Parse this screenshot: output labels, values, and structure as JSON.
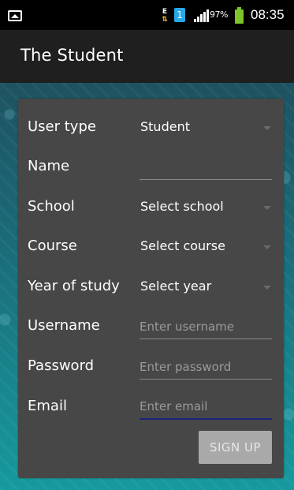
{
  "status_bar": {
    "data_indicator": "E",
    "sim_number": "1",
    "battery_percent": "97%",
    "time": "08:35",
    "battery_color": "#7ec32a",
    "sim_color": "#27a7e7"
  },
  "action_bar": {
    "title": "The Student"
  },
  "form": {
    "user_type": {
      "label": "User type",
      "value": "Student"
    },
    "name": {
      "label": "Name",
      "value": "",
      "placeholder": ""
    },
    "school": {
      "label": "School",
      "value": "Select school"
    },
    "course": {
      "label": "Course",
      "value": "Select course"
    },
    "year": {
      "label": "Year of study",
      "value": "Select year"
    },
    "username": {
      "label": "Username",
      "placeholder": "Enter username"
    },
    "password": {
      "label": "Password",
      "placeholder": "Enter password"
    },
    "email": {
      "label": "Email",
      "placeholder": "Enter email"
    },
    "signup_label": "SIGN UP"
  },
  "colors": {
    "card_background": "#474747",
    "action_bar": "#1f1f1f",
    "focus_underline": "#1a237e"
  }
}
